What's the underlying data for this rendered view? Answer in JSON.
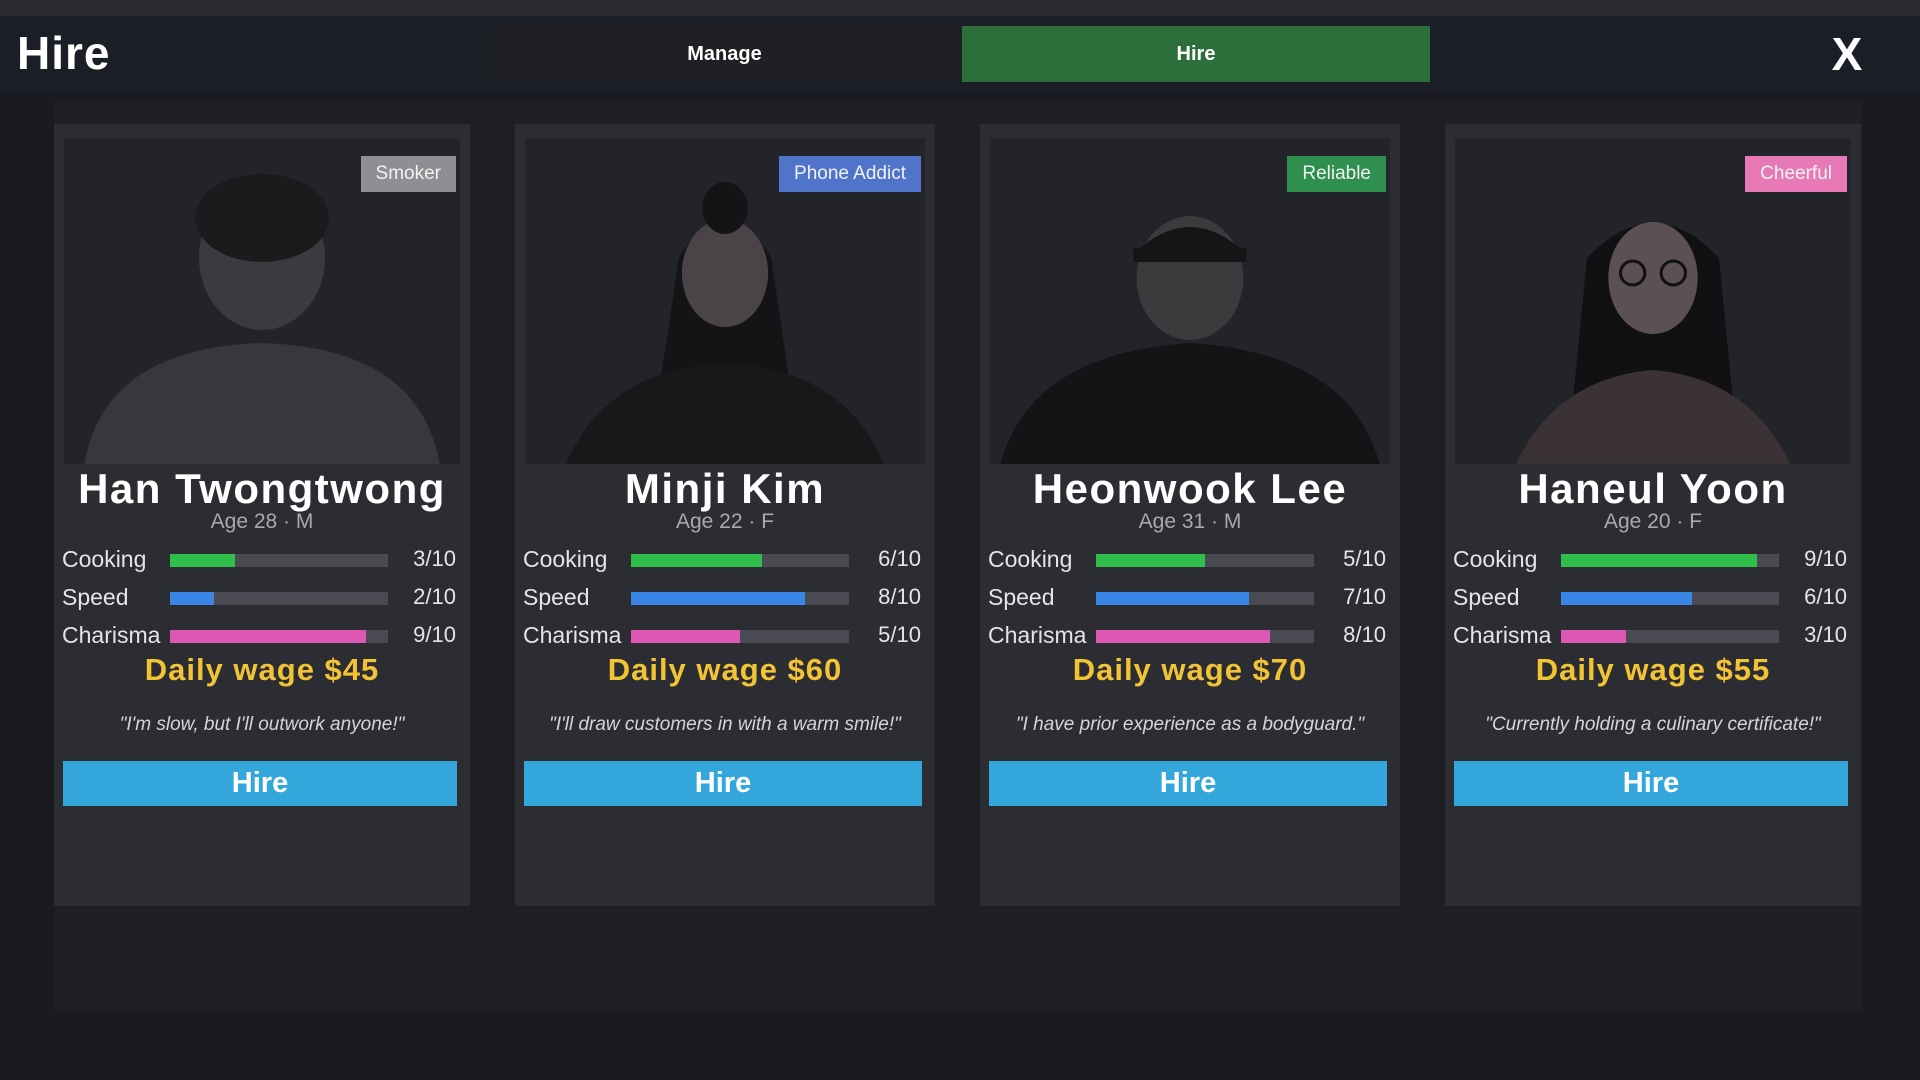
{
  "page": {
    "title": "Hire",
    "close_label": "X"
  },
  "tabs": [
    {
      "label": "Manage",
      "active": false
    },
    {
      "label": "Hire",
      "active": true
    }
  ],
  "colors": {
    "cooking": "#2fbf4a",
    "speed": "#3a86e6",
    "charisma": "#dc58b4",
    "wage": "#f2c334",
    "hire_button": "#33a7dc",
    "active_tab": "#2d6f3b"
  },
  "stat_labels": {
    "cooking": "Cooking",
    "speed": "Speed",
    "charisma": "Charisma"
  },
  "candidates": [
    {
      "name": "Han Twongtwong",
      "age_sex": "Age 28 · M",
      "trait": {
        "label": "Smoker",
        "color": "#8e8f93"
      },
      "stats": {
        "cooking": {
          "value": 3,
          "display": "3/10"
        },
        "speed": {
          "value": 2,
          "display": "2/10"
        },
        "charisma": {
          "value": 9,
          "display": "9/10"
        }
      },
      "wage": "Daily wage $45",
      "quote": "\"I'm slow, but I'll outwork anyone!\"",
      "hire_label": "Hire"
    },
    {
      "name": "Minji Kim",
      "age_sex": "Age 22 · F",
      "trait": {
        "label": "Phone Addict",
        "color": "#4f74c9"
      },
      "stats": {
        "cooking": {
          "value": 6,
          "display": "6/10"
        },
        "speed": {
          "value": 8,
          "display": "8/10"
        },
        "charisma": {
          "value": 5,
          "display": "5/10"
        }
      },
      "wage": "Daily wage $60",
      "quote": "\"I'll draw customers in with a warm smile!\"",
      "hire_label": "Hire"
    },
    {
      "name": "Heonwook Lee",
      "age_sex": "Age 31 · M",
      "trait": {
        "label": "Reliable",
        "color": "#2f8f4e"
      },
      "stats": {
        "cooking": {
          "value": 5,
          "display": "5/10"
        },
        "speed": {
          "value": 7,
          "display": "7/10"
        },
        "charisma": {
          "value": 8,
          "display": "8/10"
        }
      },
      "wage": "Daily wage $70",
      "quote": "\"I have prior experience as a bodyguard.\"",
      "hire_label": "Hire"
    },
    {
      "name": "Haneul Yoon",
      "age_sex": "Age 20 · F",
      "trait": {
        "label": "Cheerful",
        "color": "#e879b7"
      },
      "stats": {
        "cooking": {
          "value": 9,
          "display": "9/10"
        },
        "speed": {
          "value": 6,
          "display": "6/10"
        },
        "charisma": {
          "value": 3,
          "display": "3/10"
        }
      },
      "wage": "Daily wage $55",
      "quote": "\"Currently holding a culinary certificate!\"",
      "hire_label": "Hire"
    }
  ]
}
